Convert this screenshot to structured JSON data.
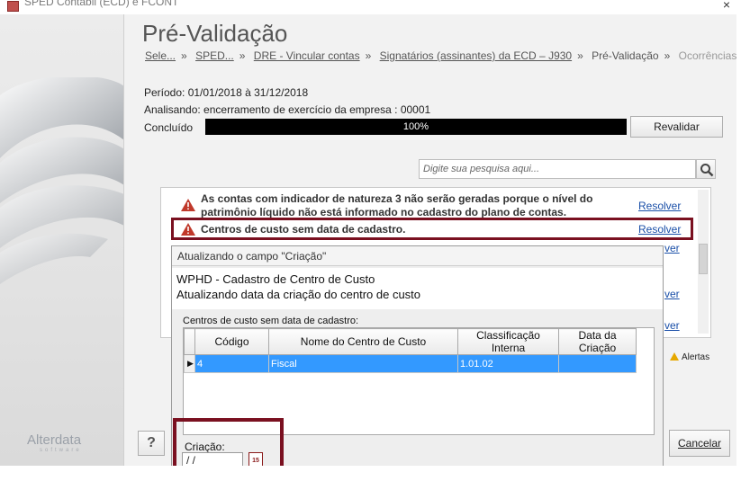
{
  "window": {
    "title": "SPED Contábil (ECD) e FCONT",
    "close": "×"
  },
  "brand": {
    "name": "Alterdata",
    "sub": "software"
  },
  "page": {
    "title": "Pré-Validação",
    "breadcrumb": [
      {
        "label": "Sele..."
      },
      {
        "label": "SPED..."
      },
      {
        "label": "DRE - Vincular contas"
      },
      {
        "label": "Signatários (assinantes) da ECD – J930"
      }
    ],
    "breadcrumb_current": "Pré-Validação",
    "breadcrumb_next": "Ocorrências",
    "sep": "»"
  },
  "info": {
    "periodo": "Período: 01/01/2018 à 31/12/2018",
    "analisando": "Analisando: encerramento de exercício da empresa : 00001",
    "concluido": "Concluído",
    "progress_text": "100%",
    "progress_value": 100
  },
  "buttons": {
    "revalidar": "Revalidar",
    "cancelar": "Cancelar",
    "help": "?"
  },
  "search": {
    "placeholder": "Digite sua pesquisa aqui..."
  },
  "occurrences": [
    {
      "text_line1": "As contas com indicador de natureza 3 não serão geradas porque o nível do",
      "text_line2": "patrimônio líquido não está informado no cadastro do plano de contas.",
      "action": "Resolver"
    },
    {
      "text_line1": "Centros de custo sem data de cadastro.",
      "action": "Resolver"
    }
  ],
  "side_links": [
    "ver",
    "ver",
    "ver"
  ],
  "alerts_label": "Alertas",
  "modal": {
    "title": "Atualizando o campo \"Criação\"",
    "head_line1": "WPHD - Cadastro de Centro de Custo",
    "head_line2": "Atualizando data da criação do centro de custo",
    "group_label": "Centros de custo sem data de cadastro:",
    "columns": [
      "Código",
      "Nome do Centro de Custo",
      "Classificação Interna",
      "Data da Criação"
    ],
    "rows": [
      {
        "indicator": "▶",
        "codigo": "4",
        "nome": "Fiscal",
        "classificacao": "1.01.02",
        "data": ""
      }
    ],
    "criacao_label": "Criação:",
    "criacao_value": " / /",
    "calendar_label": "15"
  },
  "colors": {
    "highlight": "#7a1020",
    "selection": "#3399ff",
    "link": "#1a4fa8",
    "warn": "#c0392b"
  }
}
